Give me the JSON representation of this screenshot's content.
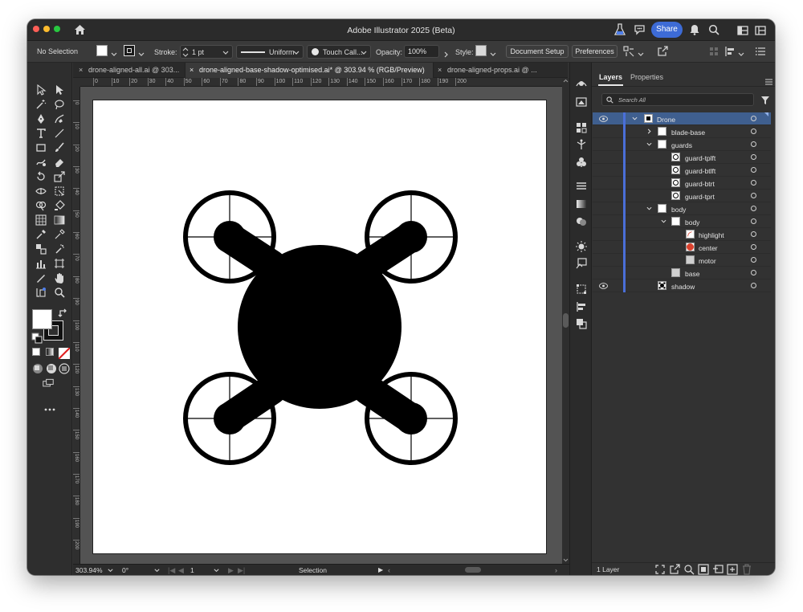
{
  "window": {
    "title": "Adobe Illustrator 2025 (Beta)",
    "share_label": "Share"
  },
  "control_bar": {
    "selection_state": "No Selection",
    "stroke_label": "Stroke:",
    "stroke_value": "1 pt",
    "profile_label": "Uniform",
    "brush_label": "Touch Call...",
    "opacity_label": "Opacity:",
    "opacity_value": "100%",
    "style_label": "Style:",
    "document_setup_label": "Document Setup",
    "preferences_label": "Preferences"
  },
  "tabs": [
    {
      "label": "drone-aligned-all.ai @ 303...",
      "active": false
    },
    {
      "label": "drone-aligned-base-shadow-optimised.ai* @ 303.94 % (RGB/Preview)",
      "active": true
    },
    {
      "label": "drone-aligned-props.ai @ ...",
      "active": false
    }
  ],
  "ruler": {
    "horizontal": [
      "0",
      "10",
      "20",
      "30",
      "40",
      "50",
      "60",
      "70",
      "80",
      "90",
      "100",
      "110",
      "120",
      "130",
      "140",
      "150",
      "160",
      "170",
      "180",
      "190",
      "200"
    ],
    "vertical": [
      "0",
      "10",
      "20",
      "30",
      "40",
      "50",
      "60",
      "70",
      "80",
      "90",
      "100",
      "110",
      "120",
      "130",
      "140",
      "150",
      "160",
      "170",
      "180",
      "190",
      "200"
    ]
  },
  "layers_panel": {
    "tab_layers": "Layers",
    "tab_properties": "Properties",
    "search_placeholder": "Search All",
    "rows": [
      {
        "name": "Drone",
        "depth": 0,
        "expanded": true,
        "visible": true,
        "selected": true
      },
      {
        "name": "blade-base",
        "depth": 1,
        "expanded": false
      },
      {
        "name": "guards",
        "depth": 1,
        "expanded": true
      },
      {
        "name": "guard-tplft",
        "depth": 2
      },
      {
        "name": "guard-btlft",
        "depth": 2
      },
      {
        "name": "guard-btrt",
        "depth": 2
      },
      {
        "name": "guard-tprt",
        "depth": 2
      },
      {
        "name": "body",
        "depth": 1,
        "expanded": true
      },
      {
        "name": "body",
        "depth": 2,
        "expanded": true
      },
      {
        "name": "highlight",
        "depth": 3
      },
      {
        "name": "center",
        "depth": 3
      },
      {
        "name": "motor",
        "depth": 3
      },
      {
        "name": "base",
        "depth": 2
      },
      {
        "name": "shadow",
        "depth": 1,
        "visible": true
      }
    ],
    "footer_count": "1 Layer"
  },
  "status_bar": {
    "zoom": "303.94%",
    "rotation": "0°",
    "artboard_number": "1",
    "tool_name": "Selection"
  },
  "colors": {
    "accent": "#3d6bd6",
    "selected_row": "#3f5f8f",
    "layer_bar": "#4a6fd8",
    "center_swatch": "#d9412d"
  }
}
